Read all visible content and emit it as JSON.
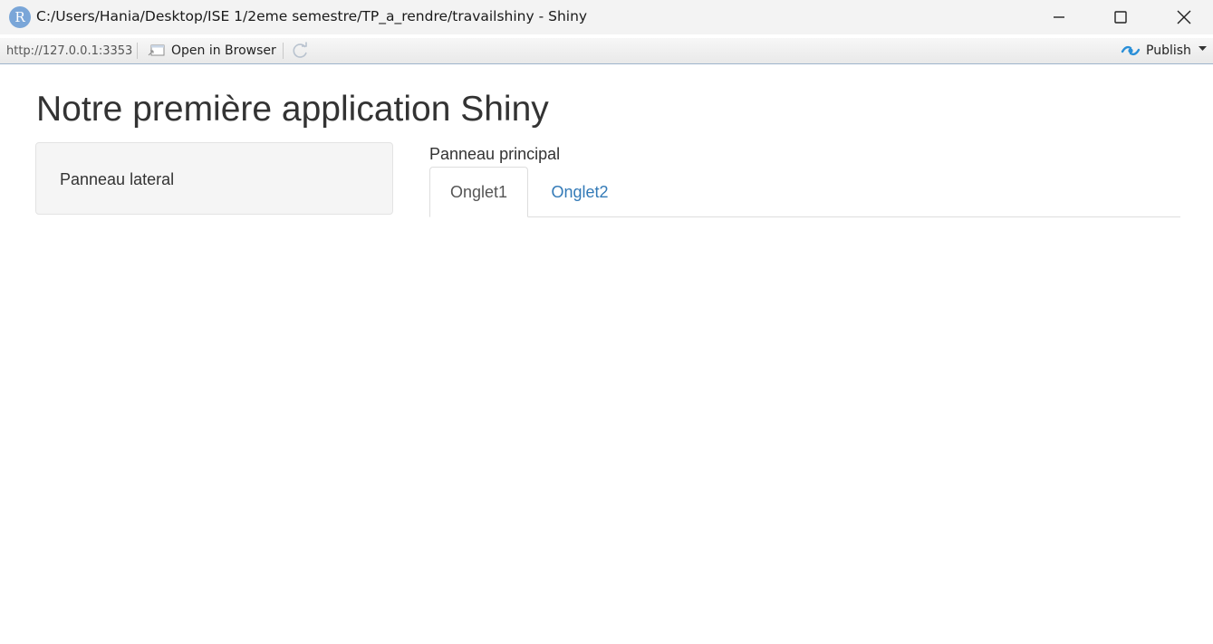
{
  "window": {
    "app_icon_letter": "R",
    "title": "C:/Users/Hania/Desktop/ISE 1/2eme semestre/TP_a_rendre/travailshiny - Shiny",
    "controls": [
      "minimize-icon",
      "maximize-icon",
      "close-icon"
    ]
  },
  "toolbar": {
    "url": "http://127.0.0.1:3353",
    "open_in_browser_label": "Open in Browser",
    "refresh_icon": "refresh-icon",
    "publish_label": "Publish",
    "publish_icon": "publish-icon",
    "accent_color": "#2a8fd8"
  },
  "app": {
    "title": "Notre première application Shiny",
    "sidebar_text": "Panneau lateral",
    "main_label": "Panneau principal",
    "tabs": [
      {
        "label": "Onglet1",
        "active": true
      },
      {
        "label": "Onglet2",
        "active": false
      }
    ],
    "link_color": "#337ab7"
  }
}
